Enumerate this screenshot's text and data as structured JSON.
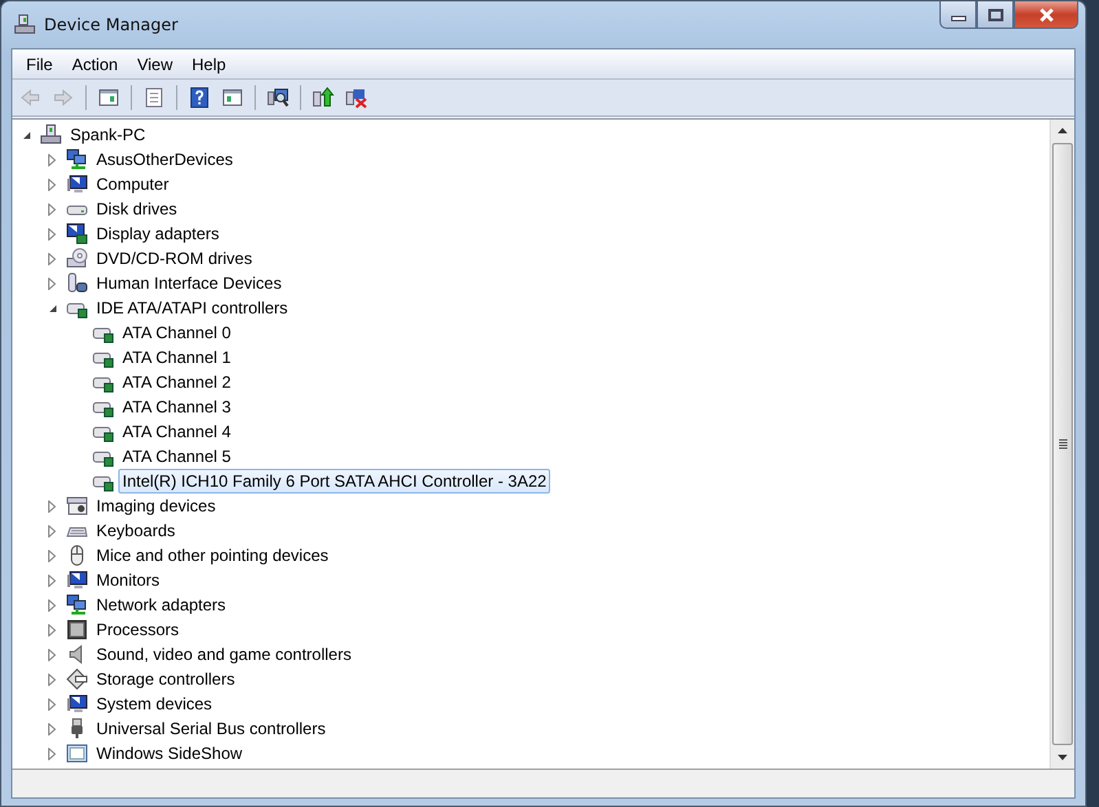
{
  "window": {
    "title": "Device Manager"
  },
  "menu": [
    "File",
    "Action",
    "View",
    "Help"
  ],
  "toolbar": [
    {
      "kind": "back",
      "disabled": true
    },
    {
      "kind": "forward",
      "disabled": true
    },
    {
      "kind": "separator"
    },
    {
      "kind": "tree-pane",
      "disabled": false
    },
    {
      "kind": "separator"
    },
    {
      "kind": "properties",
      "disabled": false
    },
    {
      "kind": "separator"
    },
    {
      "kind": "help",
      "disabled": false
    },
    {
      "kind": "action-pane",
      "disabled": false
    },
    {
      "kind": "separator"
    },
    {
      "kind": "scan",
      "disabled": false
    },
    {
      "kind": "separator"
    },
    {
      "kind": "update",
      "disabled": false
    },
    {
      "kind": "uninstall",
      "disabled": false
    }
  ],
  "tree": {
    "label": "Spank-PC",
    "kind": "computer",
    "expanded": true,
    "selected": false,
    "children": [
      {
        "label": "AsusOtherDevices",
        "kind": "network",
        "expanded": false,
        "selected": false
      },
      {
        "label": "Computer",
        "kind": "monitor",
        "expanded": false,
        "selected": false
      },
      {
        "label": "Disk drives",
        "kind": "disk",
        "expanded": false,
        "selected": false
      },
      {
        "label": "Display adapters",
        "kind": "display",
        "expanded": false,
        "selected": false
      },
      {
        "label": "DVD/CD-ROM drives",
        "kind": "dvd",
        "expanded": false,
        "selected": false
      },
      {
        "label": "Human Interface Devices",
        "kind": "hid",
        "expanded": false,
        "selected": false
      },
      {
        "label": "IDE ATA/ATAPI controllers",
        "kind": "ide",
        "expanded": true,
        "selected": false,
        "children": [
          {
            "label": "ATA Channel 0",
            "kind": "ide",
            "selected": false
          },
          {
            "label": "ATA Channel 1",
            "kind": "ide",
            "selected": false
          },
          {
            "label": "ATA Channel 2",
            "kind": "ide",
            "selected": false
          },
          {
            "label": "ATA Channel 3",
            "kind": "ide",
            "selected": false
          },
          {
            "label": "ATA Channel 4",
            "kind": "ide",
            "selected": false
          },
          {
            "label": "ATA Channel 5",
            "kind": "ide",
            "selected": false
          },
          {
            "label": "Intel(R) ICH10 Family 6 Port SATA AHCI Controller - 3A22",
            "kind": "ide",
            "selected": true
          }
        ]
      },
      {
        "label": "Imaging devices",
        "kind": "camera",
        "expanded": false,
        "selected": false
      },
      {
        "label": "Keyboards",
        "kind": "keyboard",
        "expanded": false,
        "selected": false
      },
      {
        "label": "Mice and other pointing devices",
        "kind": "mouse",
        "expanded": false,
        "selected": false
      },
      {
        "label": "Monitors",
        "kind": "monitor",
        "expanded": false,
        "selected": false
      },
      {
        "label": "Network adapters",
        "kind": "network",
        "expanded": false,
        "selected": false
      },
      {
        "label": "Processors",
        "kind": "cpu",
        "expanded": false,
        "selected": false
      },
      {
        "label": "Sound, video and game controllers",
        "kind": "sound",
        "expanded": false,
        "selected": false
      },
      {
        "label": "Storage controllers",
        "kind": "storage",
        "expanded": false,
        "selected": false
      },
      {
        "label": "System devices",
        "kind": "monitor",
        "expanded": false,
        "selected": false
      },
      {
        "label": "Universal Serial Bus controllers",
        "kind": "usb",
        "expanded": false,
        "selected": false
      },
      {
        "label": "Windows SideShow",
        "kind": "sideshow",
        "expanded": false,
        "selected": false
      }
    ]
  }
}
